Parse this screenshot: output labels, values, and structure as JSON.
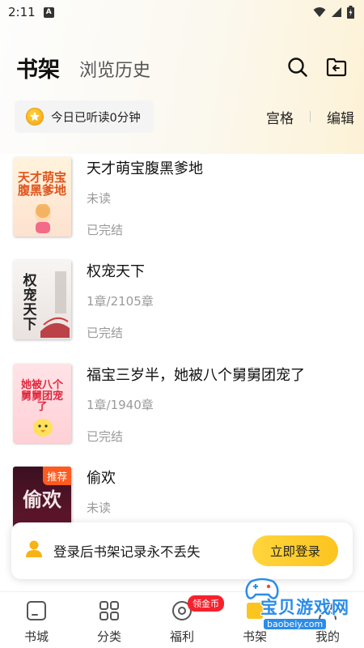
{
  "status_bar": {
    "time": "2:11",
    "app_badge": "A"
  },
  "header": {
    "tab_active": "书架",
    "tab_history": "浏览历史"
  },
  "reading": {
    "text": "今日已听读0分钟",
    "view_mode": "宫格",
    "edit": "编辑"
  },
  "books": [
    {
      "title": "天才萌宝腹黑爹地",
      "progress": "未读",
      "status": "已完结",
      "cover_text": "天才萌宝腹黑爹地",
      "tag": ""
    },
    {
      "title": "权宠天下",
      "progress": "1章/2105章",
      "status": "已完结",
      "cover_text": "权宠天下",
      "tag": ""
    },
    {
      "title": "福宝三岁半，她被八个舅舅团宠了",
      "progress": "1章/1940章",
      "status": "已完结",
      "cover_text": "她被八个舅舅团宠了",
      "tag": ""
    },
    {
      "title": "偷欢",
      "progress": "未读",
      "status": "",
      "cover_text": "偷欢",
      "tag": "推荐"
    }
  ],
  "login_banner": {
    "text": "登录后书架记录永不丢失",
    "button": "立即登录"
  },
  "bottom_nav": {
    "items": [
      {
        "label": "书城",
        "icon": "bookstore-icon"
      },
      {
        "label": "分类",
        "icon": "category-icon"
      },
      {
        "label": "福利",
        "icon": "welfare-icon",
        "badge": "领金币"
      },
      {
        "label": "书架",
        "icon": "bookshelf-icon"
      },
      {
        "label": "我的",
        "icon": "profile-icon"
      }
    ]
  },
  "watermark": {
    "name": "宝贝游戏网",
    "url": "baobeiy.com"
  },
  "colors": {
    "accent": "#fcc41f",
    "badge": "#f5222d",
    "recommend": "#ff5a1f"
  }
}
